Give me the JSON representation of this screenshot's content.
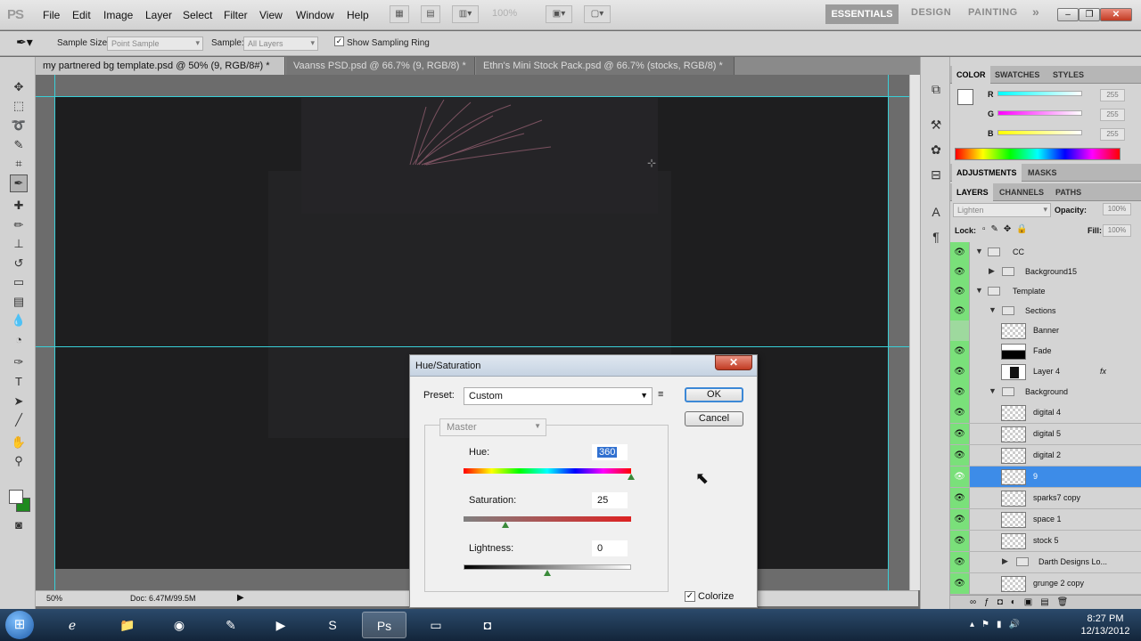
{
  "app": {
    "logo": "PS"
  },
  "menubar": {
    "items": [
      "File",
      "Edit",
      "Image",
      "Layer",
      "Select",
      "Filter",
      "View",
      "Window",
      "Help"
    ],
    "zoom": "100%",
    "workspaces": [
      "ESSENTIALS",
      "DESIGN",
      "PAINTING"
    ],
    "more": "»"
  },
  "options": {
    "sample_size_label": "Sample Size:",
    "sample_size_value": "Point Sample",
    "sample_label": "Sample:",
    "sample_value": "All Layers",
    "show_ring_label": "Show Sampling Ring",
    "show_ring_checked": true
  },
  "tabs": [
    {
      "label": "my partnered bg template.psd @ 50% (9, RGB/8#) *",
      "active": true
    },
    {
      "label": "Vaanss PSD.psd @ 66.7% (9, RGB/8) *",
      "active": false
    },
    {
      "label": "Ethn's Mini Stock Pack.psd @ 66.7% (stocks, RGB/8) *",
      "active": false
    }
  ],
  "status": {
    "zoom": "50%",
    "doc": "Doc: 6.47M/99.5M"
  },
  "color_panel": {
    "tabs": [
      "COLOR",
      "SWATCHES",
      "STYLES"
    ],
    "r_label": "R",
    "g_label": "G",
    "b_label": "B",
    "r": "255",
    "g": "255",
    "b": "255",
    "fg": "#ffffff",
    "bg": "#1f8a1f"
  },
  "adjust_panel": {
    "tabs": [
      "ADJUSTMENTS",
      "MASKS"
    ]
  },
  "layers_panel": {
    "tabs": [
      "LAYERS",
      "CHANNELS",
      "PATHS"
    ],
    "blend_mode": "Lighten",
    "opacity_label": "Opacity:",
    "opacity": "100%",
    "lock_label": "Lock:",
    "fill_label": "Fill:",
    "fill": "100%",
    "layers": [
      {
        "name": "CC"
      },
      {
        "name": "Background15"
      },
      {
        "name": "Template"
      },
      {
        "name": "Sections"
      },
      {
        "name": "Banner"
      },
      {
        "name": "Fade"
      },
      {
        "name": "Layer 4",
        "fx": "fx"
      },
      {
        "name": "Background"
      },
      {
        "name": "digital 4"
      },
      {
        "name": "digital 5"
      },
      {
        "name": "digital 2"
      },
      {
        "name": "9"
      },
      {
        "name": "sparks7 copy"
      },
      {
        "name": "space 1"
      },
      {
        "name": "stock 5"
      },
      {
        "name": "Darth Designs Lo..."
      },
      {
        "name": "grunge 2 copy"
      }
    ]
  },
  "dialog": {
    "title": "Hue/Saturation",
    "close": "✕",
    "preset_label": "Preset:",
    "preset_value": "Custom",
    "ok": "OK",
    "cancel": "Cancel",
    "channel": "Master",
    "hue_label": "Hue:",
    "hue_value": "360",
    "hue_level": 1.0,
    "saturation_label": "Saturation:",
    "saturation_value": "25",
    "saturation_level": 0.25,
    "lightness_label": "Lightness:",
    "lightness_value": "0",
    "lightness_level": 0.5,
    "colorize_label": "Colorize",
    "colorize_checked": true
  },
  "clock": {
    "time": "8:27 PM",
    "date": "12/13/2012"
  }
}
